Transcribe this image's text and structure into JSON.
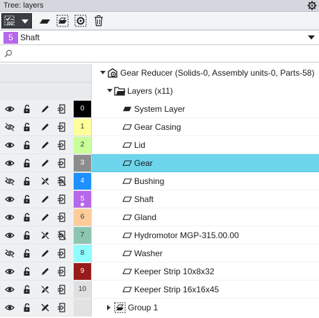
{
  "window": {
    "title": "Tree: layers"
  },
  "toolbar": {
    "buttons": [
      "layer-filter",
      "layer",
      "add-layer",
      "layer-settings",
      "delete"
    ]
  },
  "current_layer": {
    "number": "5",
    "name": "Shaft",
    "color": "#b667ea"
  },
  "search": {
    "value": "",
    "placeholder": ""
  },
  "tree": {
    "root": {
      "label": "Gear Reducer (Solids-0, Assembly units-0, Parts-58)"
    },
    "layers_group": {
      "label": "Layers (x11)"
    },
    "layers": [
      {
        "num": "0",
        "name": "System Layer",
        "color": "#000000",
        "text_color": "#ffffff",
        "visible": true,
        "editable": true,
        "printable": true,
        "system": true
      },
      {
        "num": "1",
        "name": "Gear Casing",
        "color": "#ffff99",
        "text_color": "#333333",
        "visible": false,
        "editable": true,
        "printable": true
      },
      {
        "num": "2",
        "name": "Lid",
        "color": "#c9ff99",
        "text_color": "#333333",
        "visible": true,
        "editable": true,
        "printable": true
      },
      {
        "num": "3",
        "name": "Gear",
        "color": "#8c8c8c",
        "text_color": "#ffffff",
        "visible": true,
        "editable": true,
        "printable": true,
        "selected": true
      },
      {
        "num": "4",
        "name": "Bushing",
        "color": "#1e90ff",
        "text_color": "#ffffff",
        "visible": false,
        "editable": false,
        "printable": false
      },
      {
        "num": "5",
        "name": "Shaft",
        "color": "#b667ea",
        "text_color": "#ffffff",
        "visible": true,
        "editable": true,
        "printable": true,
        "current": true
      },
      {
        "num": "6",
        "name": "Gland",
        "color": "#ffcc99",
        "text_color": "#333333",
        "visible": true,
        "editable": true,
        "printable": true
      },
      {
        "num": "7",
        "name": "Hydromotor MGP-315.00.00",
        "color": "#8cc6b0",
        "text_color": "#333333",
        "visible": true,
        "editable": false,
        "printable": false
      },
      {
        "num": "8",
        "name": "Washer",
        "color": "#8ffcff",
        "text_color": "#333333",
        "visible": false,
        "editable": true,
        "printable": true
      },
      {
        "num": "9",
        "name": "Keeper Strip 10x8x32",
        "color": "#991a1a",
        "text_color": "#ffffff",
        "visible": true,
        "editable": true,
        "printable": true
      },
      {
        "num": "10",
        "name": "Keeper Strip 16x16x45",
        "color": "#e0e0e0",
        "text_color": "#333333",
        "visible": true,
        "editable": false,
        "printable": true
      }
    ],
    "group1": {
      "label": "Group 1",
      "visible": true,
      "editable": false,
      "printable": true
    }
  }
}
